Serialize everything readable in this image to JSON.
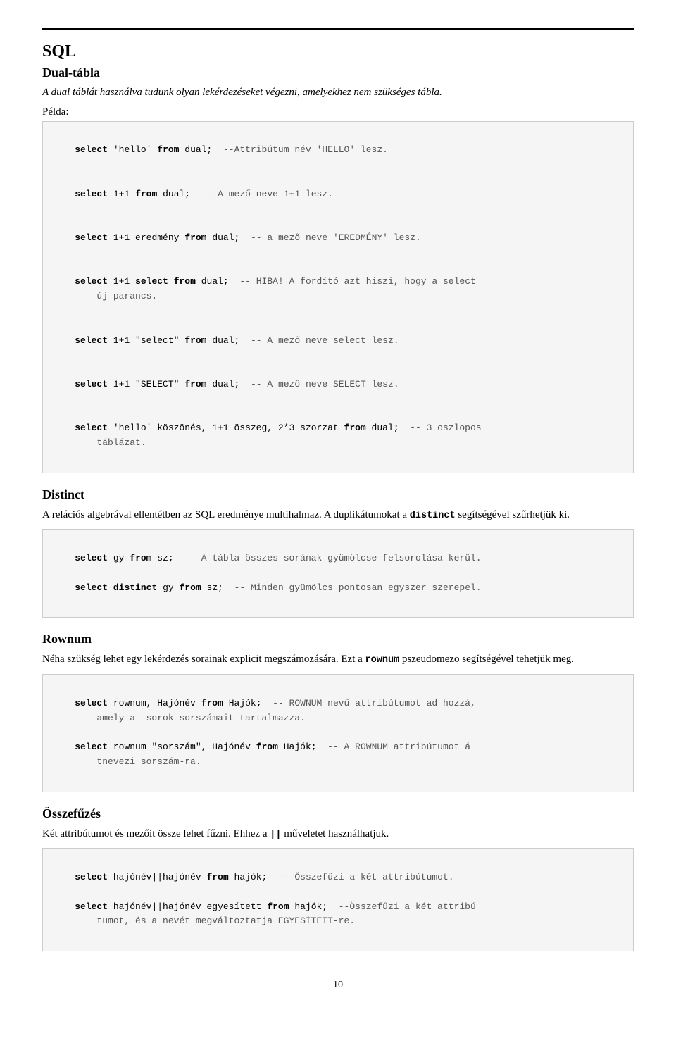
{
  "page": {
    "top_border": true,
    "main_title": "SQL",
    "page_number": "10"
  },
  "dual_section": {
    "title": "Dual-tábla",
    "intro": "A dual táblát használva tudunk olyan lekérdezéseket végezni, amelyekhez nem szükséges tábla.",
    "pelda_label": "Példa:",
    "code_lines": [
      {
        "id": "line1",
        "text": "select 'hello' from dual;  --Attribútum név 'HELLO' lesz."
      },
      {
        "id": "line2",
        "text": "select 1+1 from dual;  -- A mező neve 1+1 lesz."
      },
      {
        "id": "line3",
        "text": "select 1+1 eredmény from dual;  -- a mező neve 'EREDMÉNY' lesz."
      },
      {
        "id": "line4",
        "text": "select 1+1 select from dual;  -- HIBA! A fordító azt hiszi, hogy a select\n    új parancs."
      },
      {
        "id": "line5",
        "text": "select 1+1 \"select\" from dual;  -- A mező neve select lesz."
      },
      {
        "id": "line6",
        "text": "select 1+1 \"SELECT\" from dual;  -- A mező neve SELECT lesz."
      },
      {
        "id": "line7",
        "text": "select 'hello' köszönés, 1+1 összeg, 2*3 szorzat from dual;  -- 3 oszlopos\n    táblázat."
      }
    ]
  },
  "distinct_section": {
    "title": "Distinct",
    "body1": "A relációs algebrával ellentétben az SQL eredménye multihalmaz. A duplikátumokat a ",
    "inline_code": "distinct",
    "body2": " segítségével szűrhetjük ki.",
    "code_lines": [
      {
        "id": "d1",
        "text": "select gy from sz;  -- A tábla összes sorának gyümölcse felsorolása kerül."
      },
      {
        "id": "d2",
        "text": "select distinct gy from sz;  -- Minden gyümölcs pontosan egyszer szerepel."
      }
    ]
  },
  "rownum_section": {
    "title": "Rownum",
    "body1": "Néha szükség lehet egy lekérdezés sorainak explicit megszámozására. Ezt a ",
    "inline_code": "rownum",
    "body2": " pszeudomezo segítségével tehetjük meg.",
    "code_lines": [
      {
        "id": "r1",
        "text": "select rownum, Hajónév from Hajók;  -- ROWNUM nevű attribútumot ad hozzá,\n    amely a  sorok sorszámait tartalmazza."
      },
      {
        "id": "r2",
        "text": "select rownum \"sorszám\", Hajónév from Hajók;  -- A ROWNUM attribútumot á\n    tnevezi sorszám-ra."
      }
    ]
  },
  "osszefuzes_section": {
    "title": "Összefűzés",
    "body1": "Két attribútumot és mezőit össze lehet fűzni. Ehhez a ",
    "inline_code": "||",
    "body2": " műveletet használhatjuk.",
    "code_lines": [
      {
        "id": "o1",
        "text": "select hajónév||hajónév from hajók;  -- Összefűzi a két attribútumot."
      },
      {
        "id": "o2",
        "text": "select hajónév||hajónév egyesített from hajók;  --Összefűzi a két attribú\n    tumot, és a nevét megváltoztatja EGYESÍTETT-re."
      }
    ]
  }
}
